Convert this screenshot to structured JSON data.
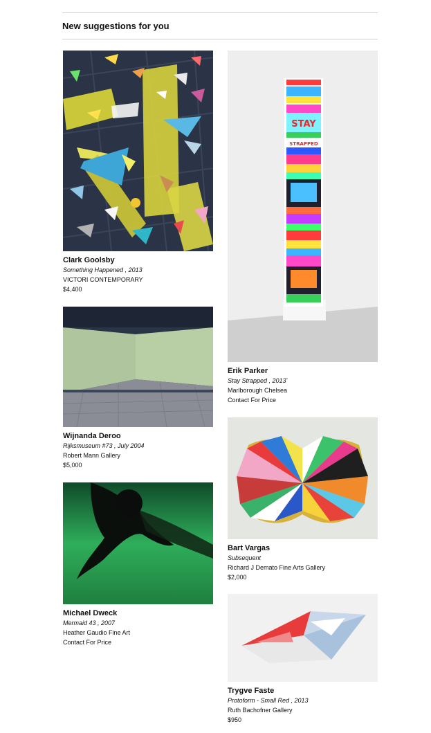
{
  "section": {
    "heading": "New suggestions for you"
  },
  "artworks": [
    {
      "artist": "Clark Goolsby",
      "title": "Something Happened , 2013",
      "gallery": "VICTORI CONTEMPORARY",
      "price": "$4,400"
    },
    {
      "artist": "Erik Parker",
      "title": "Stay Strapped , 2013`",
      "gallery": "Marlborough Chelsea",
      "price": "Contact For Price"
    },
    {
      "artist": "Wijnanda Deroo",
      "title": "Rijksmuseum #73 , July 2004",
      "gallery": "Robert Mann Gallery",
      "price": "$5,000"
    },
    {
      "artist": "Bart Vargas",
      "title": "Subsequent",
      "gallery": "Richard J Demato Fine Arts Gallery",
      "price": "$2,000"
    },
    {
      "artist": "Michael Dweck",
      "title": "Mermaid 43 , 2007",
      "gallery": "Heather Gaudio Fine Art",
      "price": "Contact For Price"
    },
    {
      "artist": "Trygve Faste",
      "title": "Protoform - Small Red , 2013",
      "gallery": "Ruth Bachofner Gallery",
      "price": "$950"
    }
  ],
  "artwork_images": {
    "goolsby": {
      "lettering": []
    },
    "parker": {
      "lettering": [
        "STAY",
        "STRAPPED"
      ]
    }
  }
}
